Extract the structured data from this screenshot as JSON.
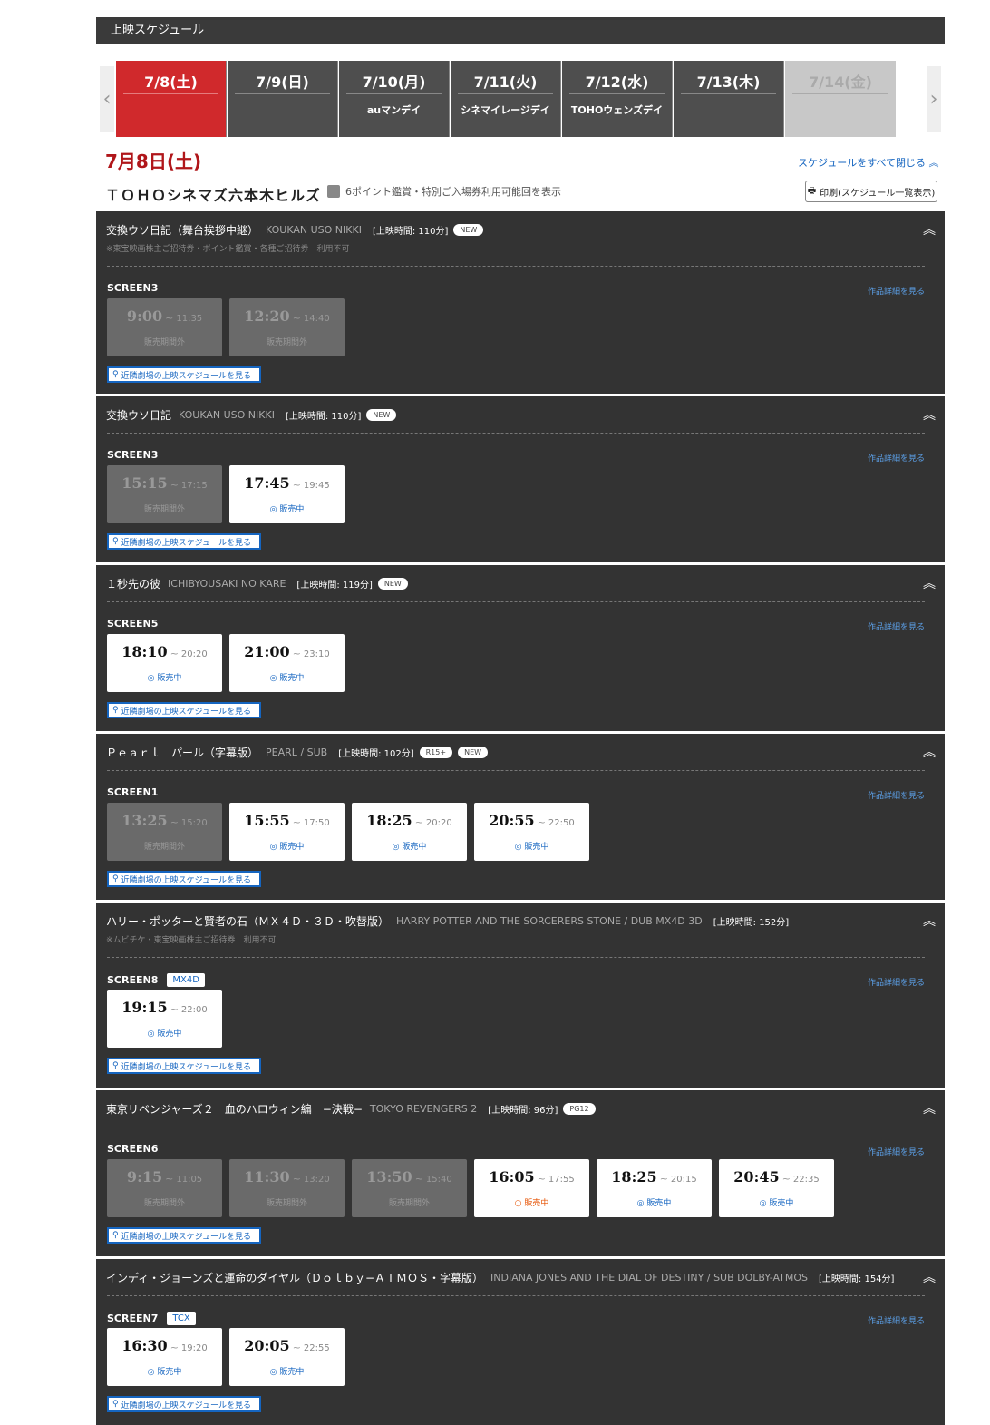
{
  "header": {
    "title": "上映スケジュール"
  },
  "date_tabs": [
    {
      "date": "7/8(土)",
      "sub": "",
      "state": "active"
    },
    {
      "date": "7/9(日)",
      "sub": "",
      "state": "normal"
    },
    {
      "date": "7/10(月)",
      "sub": "auマンデイ",
      "state": "normal"
    },
    {
      "date": "7/11(火)",
      "sub": "シネマイレージデイ",
      "state": "normal"
    },
    {
      "date": "7/12(水)",
      "sub": "TOHOウェンズデイ",
      "state": "normal"
    },
    {
      "date": "7/13(木)",
      "sub": "",
      "state": "normal"
    },
    {
      "date": "7/14(金)",
      "sub": "",
      "state": "disabled"
    }
  ],
  "selected_date": "7月8日(土)",
  "collapse_all": "スケジュールをすべて閉じる",
  "theater": "ＴＯＨＯシネマズ六本木ヒルズ",
  "legend": "6ポイント鑑賞・特別ご入場券利用可能回を表示",
  "print_button": "印刷(スケジュール一覧表示)",
  "common": {
    "detail_link": "作品詳細を見る",
    "nearby": "近隣劇場の上映スケジュールを見る",
    "status_ended": "販売期間外",
    "status_selling": "販売中"
  },
  "movies": [
    {
      "title": "交換ウソ日記（舞台挨拶中継）",
      "en": "KOUKAN USO NIKKI",
      "duration": "[上映時間: 110分]",
      "badges": [
        "NEW"
      ],
      "note": "※東宝映画株主ご招待券・ポイント鑑賞・各種ご招待券　利用不可",
      "screen": "SCREEN3",
      "format": "",
      "times": [
        {
          "start": "9:00",
          "end": "11:35",
          "status": "ended"
        },
        {
          "start": "12:20",
          "end": "14:40",
          "status": "ended"
        }
      ]
    },
    {
      "title": "交換ウソ日記",
      "en": "KOUKAN USO NIKKI",
      "duration": "[上映時間: 110分]",
      "badges": [
        "NEW"
      ],
      "note": "",
      "screen": "SCREEN3",
      "format": "",
      "times": [
        {
          "start": "15:15",
          "end": "17:15",
          "status": "ended"
        },
        {
          "start": "17:45",
          "end": "19:45",
          "status": "selling"
        }
      ]
    },
    {
      "title": "１秒先の彼",
      "en": "ICHIBYOUSAKI NO KARE",
      "duration": "[上映時間: 119分]",
      "badges": [
        "NEW"
      ],
      "note": "",
      "screen": "SCREEN5",
      "format": "",
      "times": [
        {
          "start": "18:10",
          "end": "20:20",
          "status": "selling"
        },
        {
          "start": "21:00",
          "end": "23:10",
          "status": "selling"
        }
      ]
    },
    {
      "title": "Ｐｅａｒｌ　パール（字幕版）",
      "en": "PEARL / SUB",
      "duration": "[上映時間: 102分]",
      "badges": [
        "R15+",
        "NEW"
      ],
      "note": "",
      "screen": "SCREEN1",
      "format": "",
      "times": [
        {
          "start": "13:25",
          "end": "15:20",
          "status": "ended"
        },
        {
          "start": "15:55",
          "end": "17:50",
          "status": "selling"
        },
        {
          "start": "18:25",
          "end": "20:20",
          "status": "selling"
        },
        {
          "start": "20:55",
          "end": "22:50",
          "status": "selling"
        }
      ]
    },
    {
      "title": "ハリー・ポッターと賢者の石（ＭＸ４Ｄ・３Ｄ・吹替版）",
      "en": "HARRY POTTER AND THE SORCERERS STONE / DUB MX4D 3D",
      "duration": "[上映時間: 152分]",
      "badges": [],
      "note": "※ムビチケ・東宝映画株主ご招待券　利用不可",
      "screen": "SCREEN8",
      "format": "MX4D",
      "times": [
        {
          "start": "19:15",
          "end": "22:00",
          "status": "selling"
        }
      ]
    },
    {
      "title": "東京リベンジャーズ２　血のハロウィン編　−決戦−",
      "en": "TOKYO REVENGERS 2",
      "duration": "[上映時間: 96分]",
      "badges": [
        "PG12"
      ],
      "note": "",
      "screen": "SCREEN6",
      "format": "",
      "times": [
        {
          "start": "9:15",
          "end": "11:05",
          "status": "ended"
        },
        {
          "start": "11:30",
          "end": "13:20",
          "status": "ended"
        },
        {
          "start": "13:50",
          "end": "15:40",
          "status": "ended"
        },
        {
          "start": "16:05",
          "end": "17:55",
          "status": "few"
        },
        {
          "start": "18:25",
          "end": "20:15",
          "status": "selling"
        },
        {
          "start": "20:45",
          "end": "22:35",
          "status": "selling"
        }
      ]
    },
    {
      "title": "インディ・ジョーンズと運命のダイヤル（Ｄｏｌｂｙ−ＡＴＭＯＳ・字幕版）",
      "en": "INDIANA JONES AND THE DIAL OF DESTINY / SUB DOLBY-ATMOS",
      "duration": "[上映時間: 154分]",
      "badges": [],
      "note": "",
      "screen": "SCREEN7",
      "format": "TCX",
      "times": [
        {
          "start": "16:30",
          "end": "19:20",
          "status": "selling"
        },
        {
          "start": "20:05",
          "end": "22:55",
          "status": "selling"
        }
      ]
    }
  ]
}
